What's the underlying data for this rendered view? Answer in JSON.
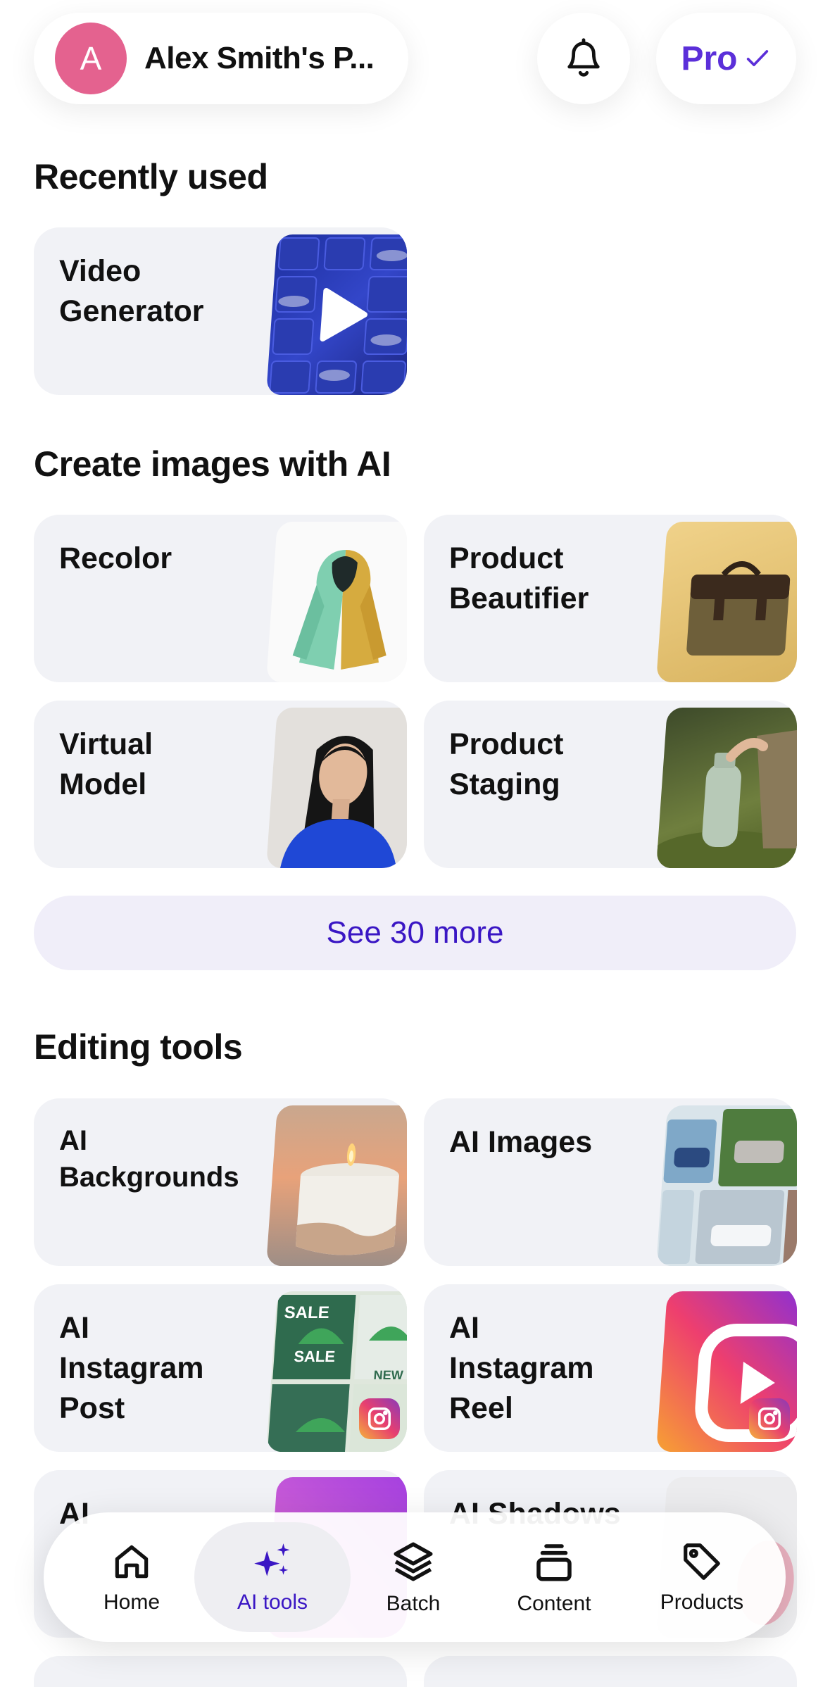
{
  "header": {
    "avatar_letter": "A",
    "profile_name": "Alex Smith's P...",
    "pro_label": "Pro"
  },
  "sections": {
    "recently_used": "Recently used",
    "create_images": "Create images with AI",
    "editing_tools": "Editing tools"
  },
  "recent_cards": [
    {
      "label": "Video\nGenerator",
      "icon": "video-play-icon"
    }
  ],
  "create_cards": [
    {
      "label": "Recolor"
    },
    {
      "label": "Product\nBeautifier"
    },
    {
      "label": "Virtual\nModel"
    },
    {
      "label": "Product\nStaging"
    }
  ],
  "see_more_label": "See 30 more",
  "editing_cards": [
    {
      "label": "AI\nBackgrounds"
    },
    {
      "label": "AI Images"
    },
    {
      "label": "AI\nInstagram\nPost",
      "badge": "instagram-icon"
    },
    {
      "label": "AI\nInstagram\nReel",
      "badge": "instagram-icon"
    },
    {
      "label": "AI"
    },
    {
      "label": "AI Shadows"
    }
  ],
  "bottom_nav": [
    {
      "label": "Home",
      "icon": "home-icon"
    },
    {
      "label": "AI tools",
      "icon": "sparkles-icon",
      "active": true
    },
    {
      "label": "Batch",
      "icon": "layers-icon"
    },
    {
      "label": "Content",
      "icon": "stack-icon"
    },
    {
      "label": "Products",
      "icon": "tag-icon"
    }
  ],
  "colors": {
    "accent": "#3a16c4",
    "pro": "#5b2fd9",
    "avatar": "#e4628f",
    "card_bg": "#f1f2f6"
  }
}
